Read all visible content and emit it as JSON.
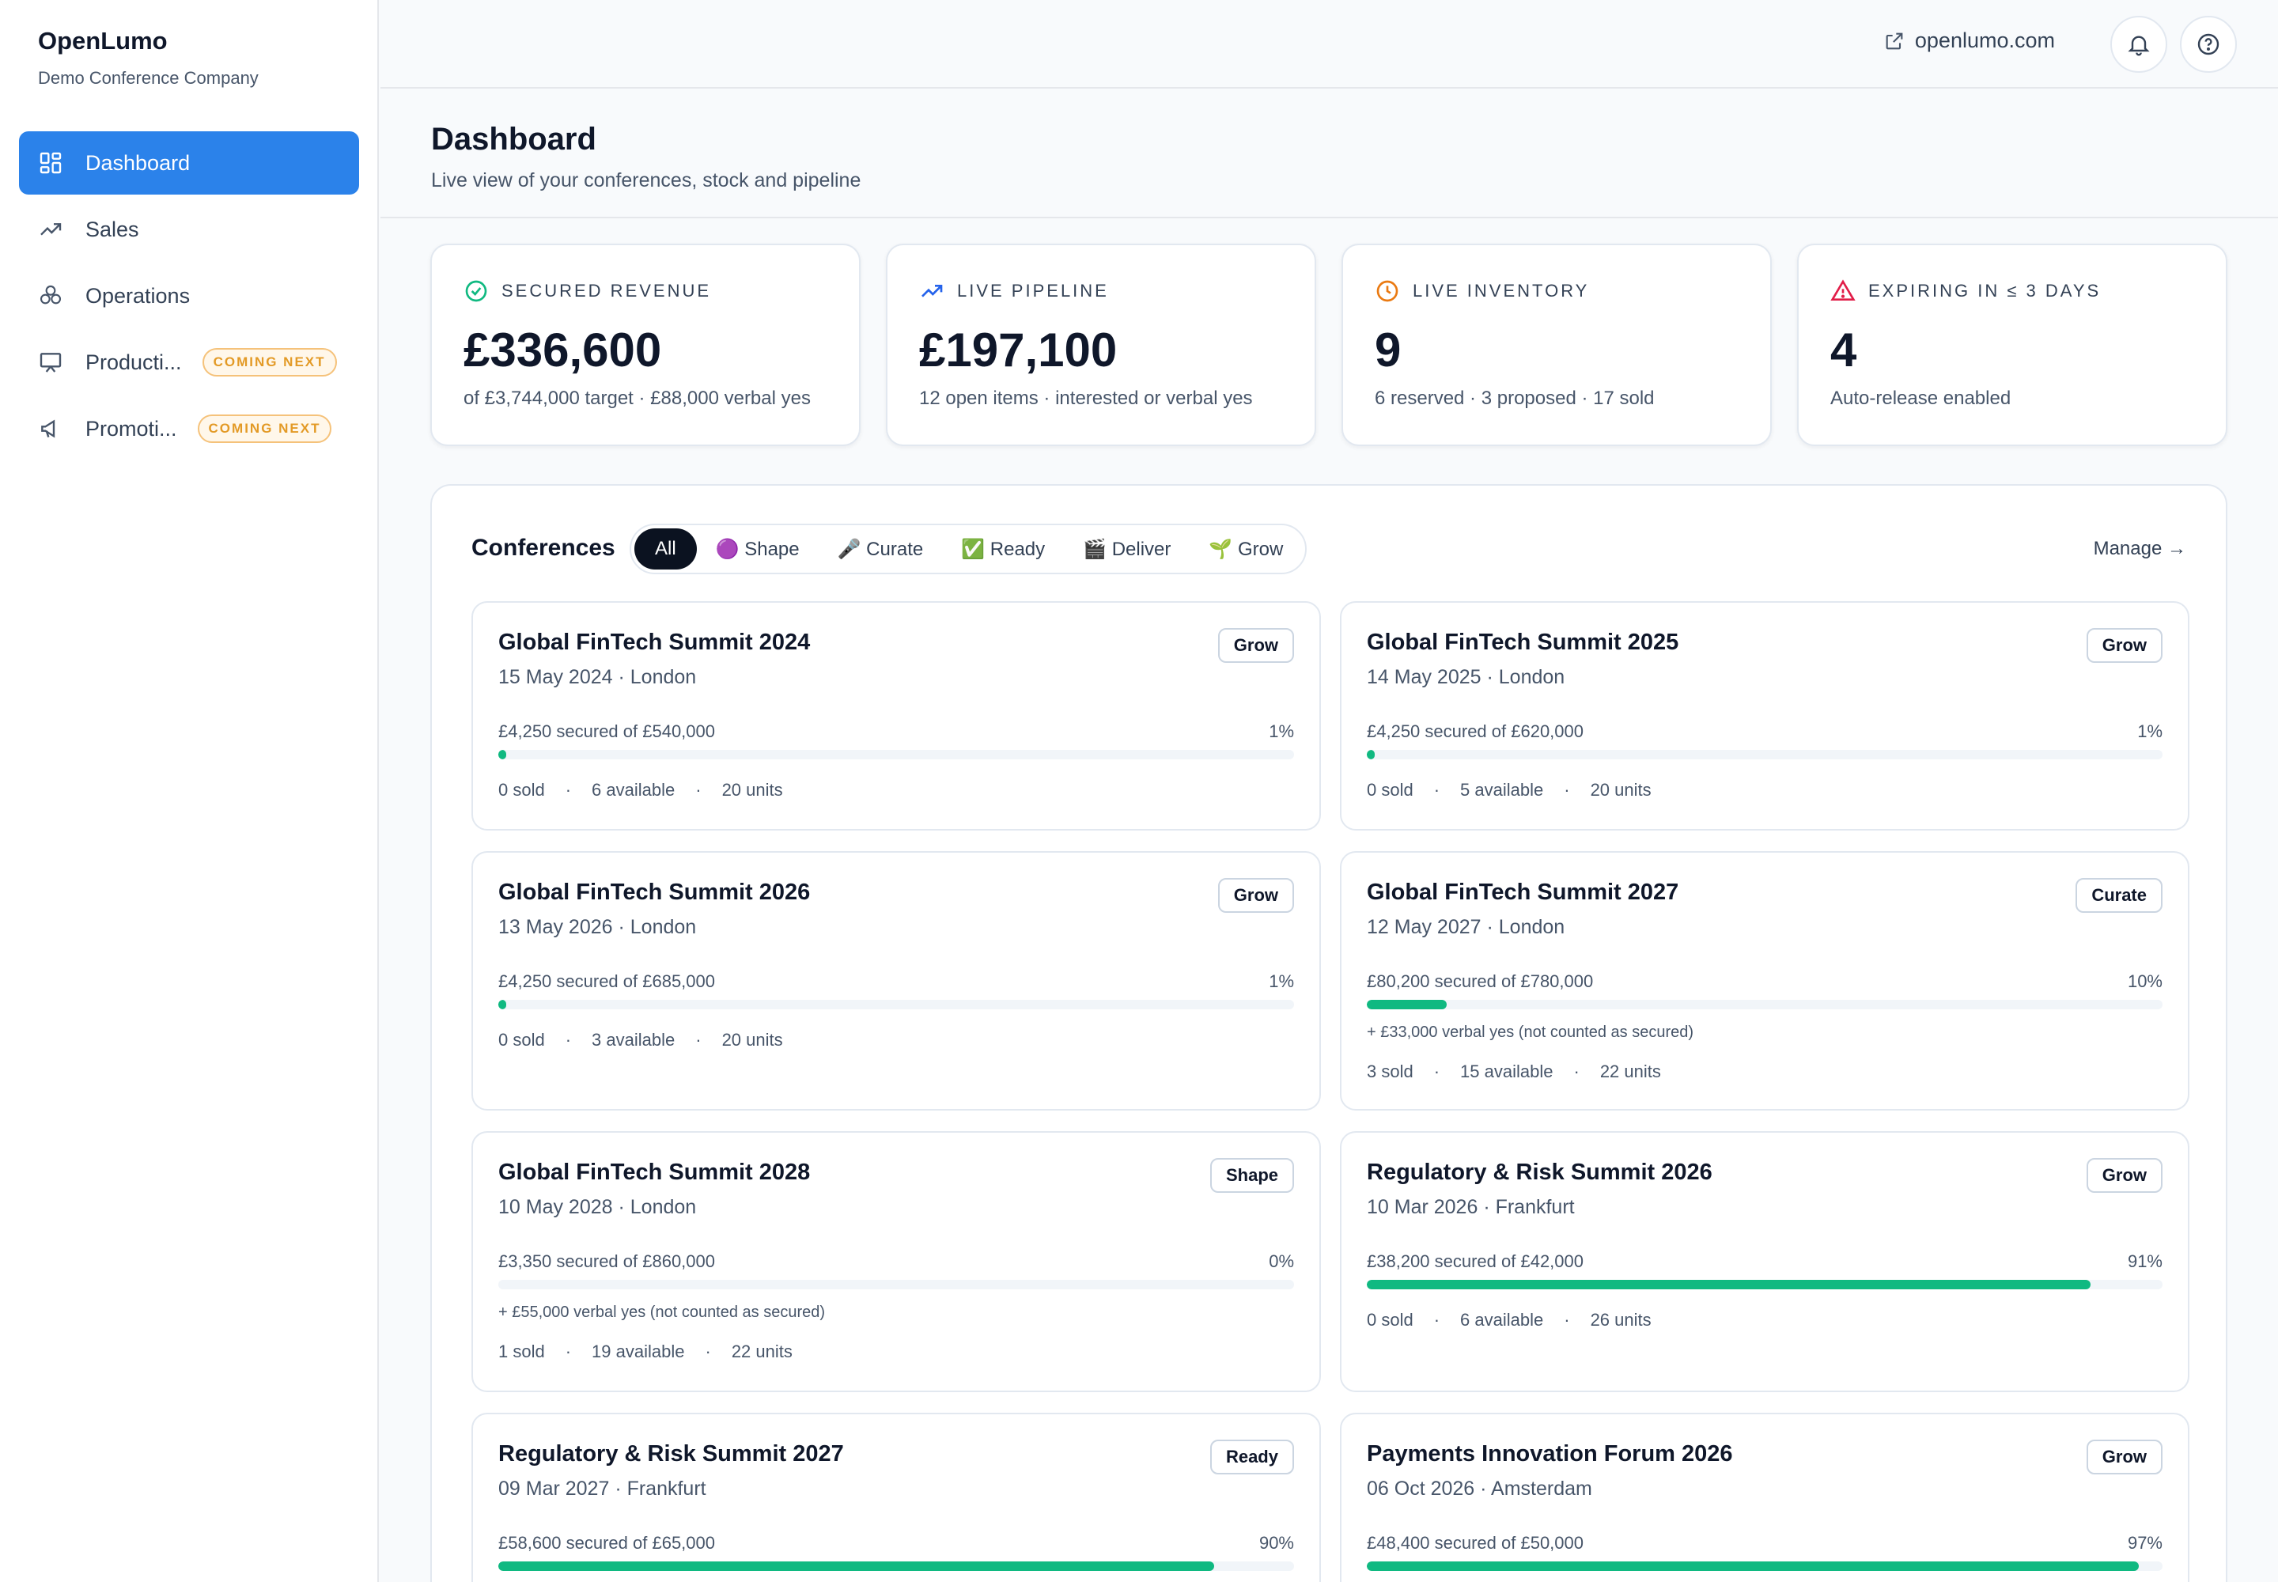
{
  "app": {
    "name": "OpenLumo",
    "company": "Demo Conference Company"
  },
  "sidebar": {
    "items": [
      {
        "label": "Dashboard",
        "icon": "dashboard-icon",
        "active": true
      },
      {
        "label": "Sales",
        "icon": "trend-up-icon"
      },
      {
        "label": "Operations",
        "icon": "cubes-icon"
      },
      {
        "label": "Producti...",
        "icon": "presentation-icon",
        "badge": "COMING NEXT"
      },
      {
        "label": "Promoti...",
        "icon": "megaphone-icon",
        "badge": "COMING NEXT"
      }
    ]
  },
  "topbar": {
    "site_link": "openlumo.com"
  },
  "header": {
    "title": "Dashboard",
    "subtitle": "Live view of your conferences, stock and pipeline"
  },
  "stats": [
    {
      "label": "SECURED REVENUE",
      "value": "£336,600",
      "note": "of £3,744,000 target · £88,000 verbal yes",
      "icon": "check-circle-icon",
      "color": "#10b981"
    },
    {
      "label": "LIVE PIPELINE",
      "value": "£197,100",
      "note": "12 open items · interested or verbal yes",
      "icon": "trend-up-icon",
      "color": "#2563eb"
    },
    {
      "label": "LIVE INVENTORY",
      "value": "9",
      "note": "6 reserved · 3 proposed · 17 sold",
      "icon": "clock-icon",
      "color": "#ea7a12"
    },
    {
      "label": "EXPIRING IN ≤ 3 DAYS",
      "value": "4",
      "note": "Auto-release enabled",
      "icon": "warning-icon",
      "color": "#e11d48"
    }
  ],
  "conferences": {
    "title": "Conferences",
    "filters": [
      "All",
      "🟣 Shape",
      "🎤 Curate",
      "✅ Ready",
      "🎬 Deliver",
      "🌱 Grow"
    ],
    "manage": "Manage →",
    "cards": [
      {
        "name": "Global FinTech Summit 2024",
        "date": "15 May 2024 · London",
        "stage": "Grow",
        "secured": "£4,250 secured of £540,000",
        "pct": "1%",
        "progress": 0.01,
        "verbal": "",
        "sold": "0 sold",
        "available": "6 available",
        "units": "20 units"
      },
      {
        "name": "Global FinTech Summit 2025",
        "date": "14 May 2025 · London",
        "stage": "Grow",
        "secured": "£4,250 secured of £620,000",
        "pct": "1%",
        "progress": 0.01,
        "verbal": "",
        "sold": "0 sold",
        "available": "5 available",
        "units": "20 units"
      },
      {
        "name": "Global FinTech Summit 2026",
        "date": "13 May 2026 · London",
        "stage": "Grow",
        "secured": "£4,250 secured of £685,000",
        "pct": "1%",
        "progress": 0.01,
        "verbal": "",
        "sold": "0 sold",
        "available": "3 available",
        "units": "20 units"
      },
      {
        "name": "Global FinTech Summit 2027",
        "date": "12 May 2027 · London",
        "stage": "Curate",
        "secured": "£80,200 secured of £780,000",
        "pct": "10%",
        "progress": 0.1,
        "verbal": "+ £33,000 verbal yes (not counted as secured)",
        "sold": "3 sold",
        "available": "15 available",
        "units": "22 units"
      },
      {
        "name": "Global FinTech Summit 2028",
        "date": "10 May 2028 · London",
        "stage": "Shape",
        "secured": "£3,350 secured of £860,000",
        "pct": "0%",
        "progress": 0.0,
        "verbal": "+ £55,000 verbal yes (not counted as secured)",
        "sold": "1 sold",
        "available": "19 available",
        "units": "22 units"
      },
      {
        "name": "Regulatory & Risk Summit 2026",
        "date": "10 Mar 2026 · Frankfurt",
        "stage": "Grow",
        "secured": "£38,200 secured of £42,000",
        "pct": "91%",
        "progress": 0.91,
        "verbal": "",
        "sold": "0 sold",
        "available": "6 available",
        "units": "26 units"
      },
      {
        "name": "Regulatory & Risk Summit 2027",
        "date": "09 Mar 2027 · Frankfurt",
        "stage": "Ready",
        "secured": "£58,600 secured of £65,000",
        "pct": "90%",
        "progress": 0.9,
        "verbal": "",
        "sold": "",
        "available": "",
        "units": ""
      },
      {
        "name": "Payments Innovation Forum 2026",
        "date": "06 Oct 2026 · Amsterdam",
        "stage": "Grow",
        "secured": "£48,400 secured of £50,000",
        "pct": "97%",
        "progress": 0.97,
        "verbal": "",
        "sold": "",
        "available": "",
        "units": ""
      }
    ]
  }
}
